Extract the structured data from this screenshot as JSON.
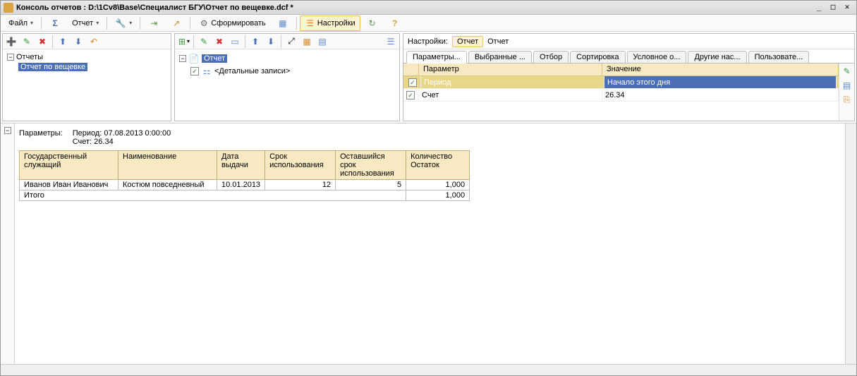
{
  "window": {
    "title": "Консоль отчетов : D:\\1Cv8\\Base\\Специалист БГУ\\Отчет по вещевке.dcf *"
  },
  "menubar": {
    "file": "Файл",
    "report": "Отчет",
    "form": "Сформировать",
    "settings": "Настройки"
  },
  "left_panel": {
    "root": "Отчеты",
    "item": "Отчет по вещевке"
  },
  "center_panel": {
    "root": "Отчет",
    "detail": "<Детальные записи>"
  },
  "right_panel": {
    "label": "Настройки:",
    "chip_active": "Отчет",
    "chip": "Отчет",
    "tabs": {
      "params": "Параметры...",
      "selected": "Выбранные ...",
      "filter": "Отбор",
      "sort": "Сортировка",
      "cond": "Условное о...",
      "other": "Другие нас...",
      "user": "Пользовате..."
    },
    "header_param": "Параметр",
    "header_value": "Значение",
    "rows": [
      {
        "name": "Период",
        "value": "Начало этого дня",
        "checked": true
      },
      {
        "name": "Счет",
        "value": "26.34",
        "checked": true
      }
    ]
  },
  "report": {
    "params_label": "Параметры:",
    "period_line": "Период: 07.08.2013 0:00:00",
    "account_line": "Счет: 26.34",
    "columns": {
      "c1": "Государственный служащий",
      "c2": "Наименование",
      "c3": "Дата выдачи",
      "c4": "Срок использования",
      "c5": "Оставшийся срок использования",
      "c6": "Количество Остаток"
    },
    "row": {
      "c1": "Иванов Иван Иванович",
      "c2": "Костюм повседневный",
      "c3": "10.01.2013",
      "c4": "12",
      "c5": "5",
      "c6": "1,000"
    },
    "total_label": "Итого",
    "total_value": "1,000"
  }
}
